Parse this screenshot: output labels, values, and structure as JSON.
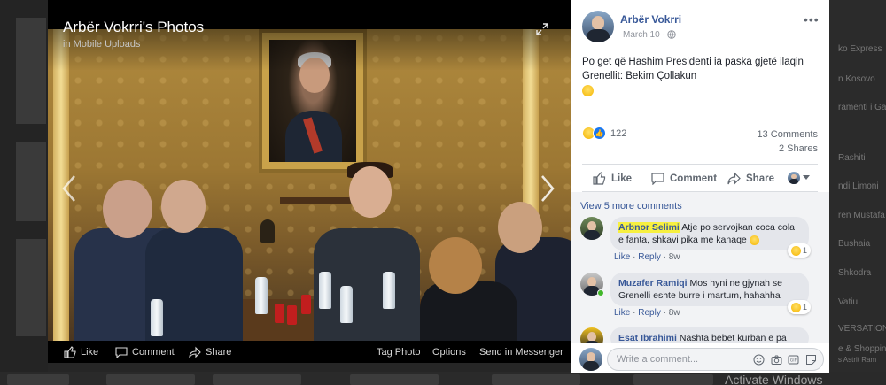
{
  "viewer": {
    "title": "Arbër Vokrri's Photos",
    "subtitle": "in Mobile Uploads",
    "bar": {
      "like": "Like",
      "comment": "Comment",
      "share": "Share",
      "tag_photo": "Tag Photo",
      "options": "Options",
      "send_in_messenger": "Send in Messenger"
    }
  },
  "post": {
    "author": "Arbër Vokrri",
    "date": "March 10 ·",
    "text": "Po get që Hashim Presidenti ia paska gjetë ilaqin Grenellit: Bekim Çollakun",
    "reaction_count": "122",
    "comments_count": "13 Comments",
    "shares_count": "2 Shares",
    "actions": {
      "like": "Like",
      "comment": "Comment",
      "share": "Share"
    }
  },
  "comments": {
    "view_more": "View 5 more comments",
    "items": [
      {
        "name": "Arbnor Selimi",
        "text": "Atje po servojkan coca cola e fanta, shkavi pika me kanaqe",
        "like": "Like",
        "reply": "Reply",
        "time": "8w",
        "reaction_count": "1"
      },
      {
        "name": "Muzafer Ramiqi",
        "text": "Mos hyni ne gjynah se Grenelli eshte burre i martum, hahahha",
        "like": "Like",
        "reply": "Reply",
        "time": "8w",
        "reaction_count": "1"
      },
      {
        "name": "Esat Ibrahimi",
        "text": "Nashta bebet kurban e pa"
      }
    ]
  },
  "composer": {
    "placeholder": "Write a comment..."
  },
  "background": {
    "right_items": [
      "ko Express",
      "n Kosovo",
      "ramenti i Gaz",
      "Rashiti",
      "ndi Limoni",
      "ren Mustafa",
      "Bushaia",
      "Shkodra",
      "Vatiu",
      "VERSATIONS",
      "e & Shoppin",
      "s Astrit Ram"
    ],
    "watermark": "Activate Windows"
  },
  "colors": {
    "link": "#385898",
    "highlight": "#f7f040",
    "online": "#42b72a"
  }
}
